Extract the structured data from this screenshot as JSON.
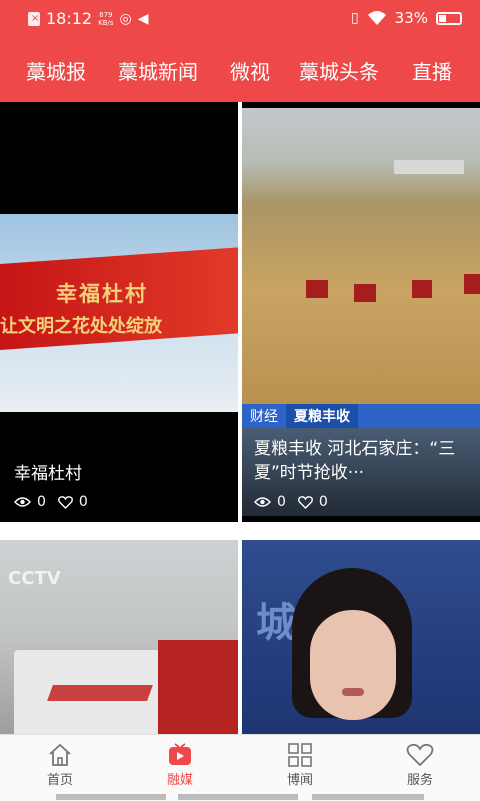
{
  "status_bar": {
    "time": "18:12",
    "speed_top": "879",
    "speed_unit": "KB/s",
    "battery": "33%"
  },
  "tabs": [
    "藁城报",
    "藁城新闻",
    "微视",
    "藁城头条",
    "直播"
  ],
  "cards": [
    {
      "banner_line1": "幸福杜村",
      "banner_line2": "让文明之花处处绽放",
      "title": "幸福杜村",
      "views": "0",
      "likes": "0"
    },
    {
      "tag1": "财经",
      "tag2": "夏粮丰收",
      "title": "夏粮丰收 河北石家庄：“三夏”时节抢收···",
      "views": "0",
      "likes": "0"
    },
    {
      "logo": "CCTV"
    },
    {
      "bg_text": "城 公安"
    }
  ],
  "bottom_nav": [
    {
      "label": "首页",
      "icon": "home-icon"
    },
    {
      "label": "融媒",
      "icon": "media-play-icon"
    },
    {
      "label": "博闻",
      "icon": "grid-icon"
    },
    {
      "label": "服务",
      "icon": "heart-icon"
    }
  ],
  "colors": {
    "brand": "#ef4848"
  }
}
